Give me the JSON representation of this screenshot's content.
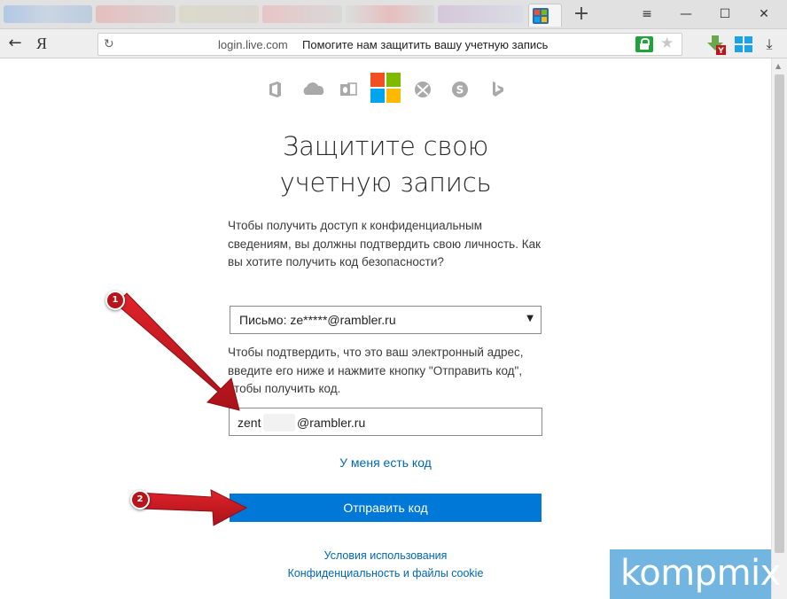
{
  "browser": {
    "url_host": "login.live.com",
    "tab_title": "Помогите нам защитить вашу учетную запись",
    "search_logo": "Я"
  },
  "colors": {
    "accent": "#0078d7",
    "link": "#0067b8",
    "annotation": "#c8161d",
    "lock": "#20a33a",
    "watermark": "#0078c8"
  },
  "product_icons": [
    "office-icon",
    "onedrive-icon",
    "outlook-icon",
    "microsoft-logo",
    "xbox-icon",
    "skype-icon",
    "bing-icon"
  ],
  "page": {
    "title_line1": "Защитите свою",
    "title_line2": "учетную запись",
    "intro_text": "Чтобы получить доступ к конфиденциальным сведениям, вы должны подтвердить свою личность. Как вы хотите получить код безопасности?",
    "method_select_value": "Письмо: ze*****@rambler.ru",
    "confirm_text": "Чтобы подтвердить, что это ваш электронный адрес, введите его ниже и нажмите кнопку \"Отправить код\", чтобы получить код.",
    "email_value_start": "zent",
    "email_value_end": "@rambler.ru",
    "have_code_link": "У меня есть код",
    "send_button": "Отправить код",
    "terms_link": "Условия использования",
    "privacy_link": "Конфиденциальность и файлы cookie"
  },
  "annotations": {
    "step1": "1",
    "step2": "2"
  },
  "watermark": "kompmix"
}
